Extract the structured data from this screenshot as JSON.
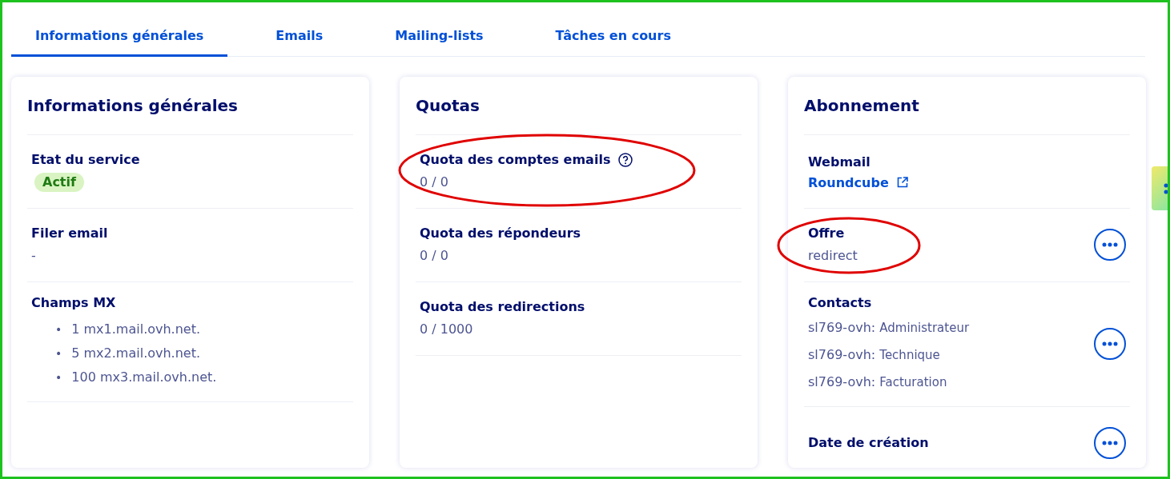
{
  "tabs": [
    {
      "label": "Informations générales",
      "selected": true
    },
    {
      "label": "Emails",
      "selected": false
    },
    {
      "label": "Mailing-lists",
      "selected": false
    },
    {
      "label": "Tâches en cours",
      "selected": false
    }
  ],
  "cards": [
    {
      "title": "Informations générales",
      "items": [
        {
          "kind": "badge",
          "label": "Etat du service",
          "value": "Actif"
        },
        {
          "kind": "text",
          "label": "Filer email",
          "value": "-"
        },
        {
          "kind": "list",
          "label": "Champs MX",
          "bullet": "•",
          "values": [
            "1 mx1.mail.ovh.net.",
            "5 mx2.mail.ovh.net.",
            "100 mx3.mail.ovh.net."
          ]
        }
      ]
    },
    {
      "title": "Quotas",
      "items": [
        {
          "kind": "text",
          "label": "Quota des comptes emails",
          "value": "0 / 0",
          "help": true,
          "circled": true
        },
        {
          "kind": "text",
          "label": "Quota des répondeurs",
          "value": "0 / 0"
        },
        {
          "kind": "text",
          "label": "Quota des redirections",
          "value": "0 / 1000"
        }
      ]
    },
    {
      "title": "Abonnement",
      "items": [
        {
          "kind": "link",
          "label": "Webmail",
          "value": "Roundcube"
        },
        {
          "kind": "text",
          "label": "Offre",
          "value": "redirect",
          "menu": true,
          "circled": true
        },
        {
          "kind": "contacts",
          "label": "Contacts",
          "menu": true,
          "contacts": [
            {
              "account": "sl769-ovh:",
              "role": "Administrateur"
            },
            {
              "account": "sl769-ovh:",
              "role": "Technique"
            },
            {
              "account": "sl769-ovh:",
              "role": "Facturation"
            }
          ]
        },
        {
          "kind": "label",
          "label": "Date de création",
          "menu": true
        }
      ]
    }
  ]
}
